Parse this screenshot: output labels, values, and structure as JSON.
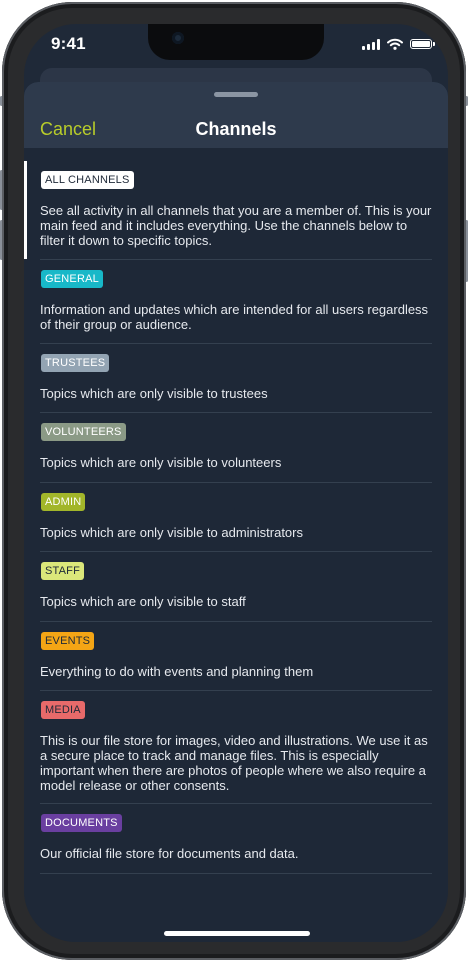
{
  "status_bar": {
    "time": "9:41"
  },
  "sheet": {
    "cancel_label": "Cancel",
    "title": "Channels"
  },
  "channels": [
    {
      "label": "ALL CHANNELS",
      "description": "See all activity in all channels that you are a member of. This is your main feed and it includes everything. Use the channels below to filter it down to specific topics.",
      "chip_bg": "#ffffff",
      "chip_fg": "#1f2938",
      "selected": true
    },
    {
      "label": "GENERAL",
      "description": "Information and updates which are intended for all users regardless of their group or audience.",
      "chip_bg": "#18b8c8",
      "chip_fg": "#ffffff"
    },
    {
      "label": "TRUSTEES",
      "description": "Topics which are only visible to trustees",
      "chip_bg": "#93a4b3",
      "chip_fg": "#ffffff"
    },
    {
      "label": "VOLUNTEERS",
      "description": "Topics which are only visible to volunteers",
      "chip_bg": "#8b9a86",
      "chip_fg": "#ffffff"
    },
    {
      "label": "ADMIN",
      "description": "Topics which are only visible to administrators",
      "chip_bg": "#a2b62a",
      "chip_fg": "#ffffff"
    },
    {
      "label": "STAFF",
      "description": "Topics which are only visible to staff",
      "chip_bg": "#dbe77a",
      "chip_fg": "#1f2938"
    },
    {
      "label": "EVENTS",
      "description": "Everything to do with events and planning them",
      "chip_bg": "#f4a515",
      "chip_fg": "#1f2938"
    },
    {
      "label": "MEDIA",
      "description": "This is our file store for images, video and illustrations. We use it as a secure place to track and manage files. This is especially important when there are photos of people where we also require a model release or other consents.",
      "chip_bg": "#e86a6a",
      "chip_fg": "#1f2938"
    },
    {
      "label": "DOCUMENTS",
      "description": "Our official file store for documents and data.",
      "chip_bg": "#6a3fa0",
      "chip_fg": "#ffffff"
    }
  ],
  "icons": [
    "camera-icon",
    "signal-icon",
    "wifi-icon",
    "battery-icon"
  ]
}
